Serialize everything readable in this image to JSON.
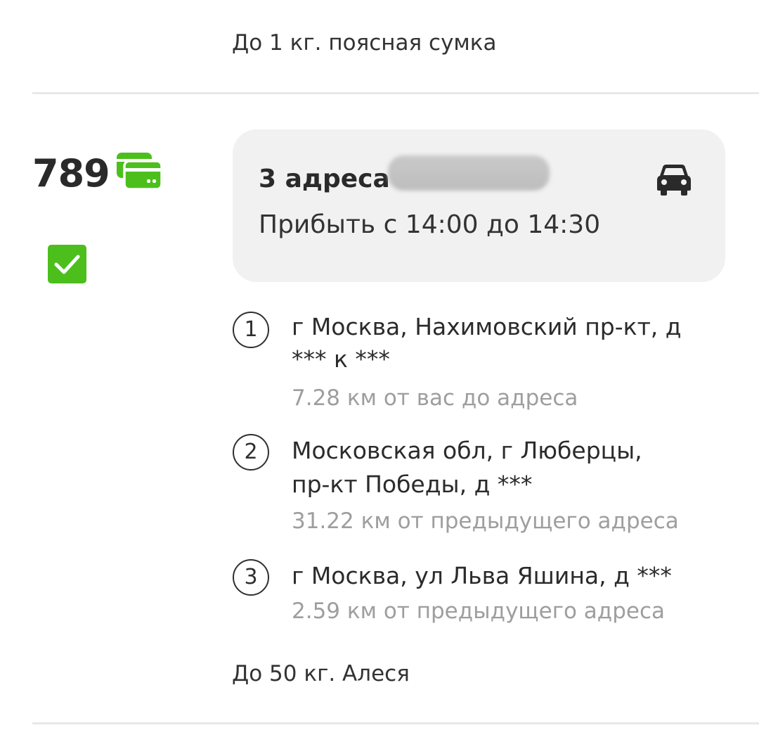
{
  "previous_order": {
    "note": "До 1 кг. поясная сумка"
  },
  "order": {
    "price": "789",
    "summary": {
      "title": "3 адреса",
      "arrival": "Прибыть с 14:00 до 14:30"
    },
    "addresses": [
      {
        "number": "1",
        "lines": [
          "г Москва, Нахимовский пр-кт, д",
          "*** к ***"
        ],
        "distance": "7.28 км от вас до адреса"
      },
      {
        "number": "2",
        "lines": [
          "Московская обл, г Люберцы,",
          "пр-кт Победы, д ***"
        ],
        "distance": "31.22 км от предыдущего адреса"
      },
      {
        "number": "3",
        "lines": [
          "г Москва, ул Льва Яшина, д ***"
        ],
        "distance": "2.59 км от предыдущего адреса"
      }
    ],
    "note": "До 50 кг. Алеся"
  },
  "icons": {
    "payment": "credit-card-icon",
    "checkbox": "checkmark-icon",
    "transport": "car-icon"
  },
  "colors": {
    "accent_green": "#4cbf1d",
    "summary_bg": "#f1f1f1",
    "muted_text": "#9e9e9e"
  }
}
